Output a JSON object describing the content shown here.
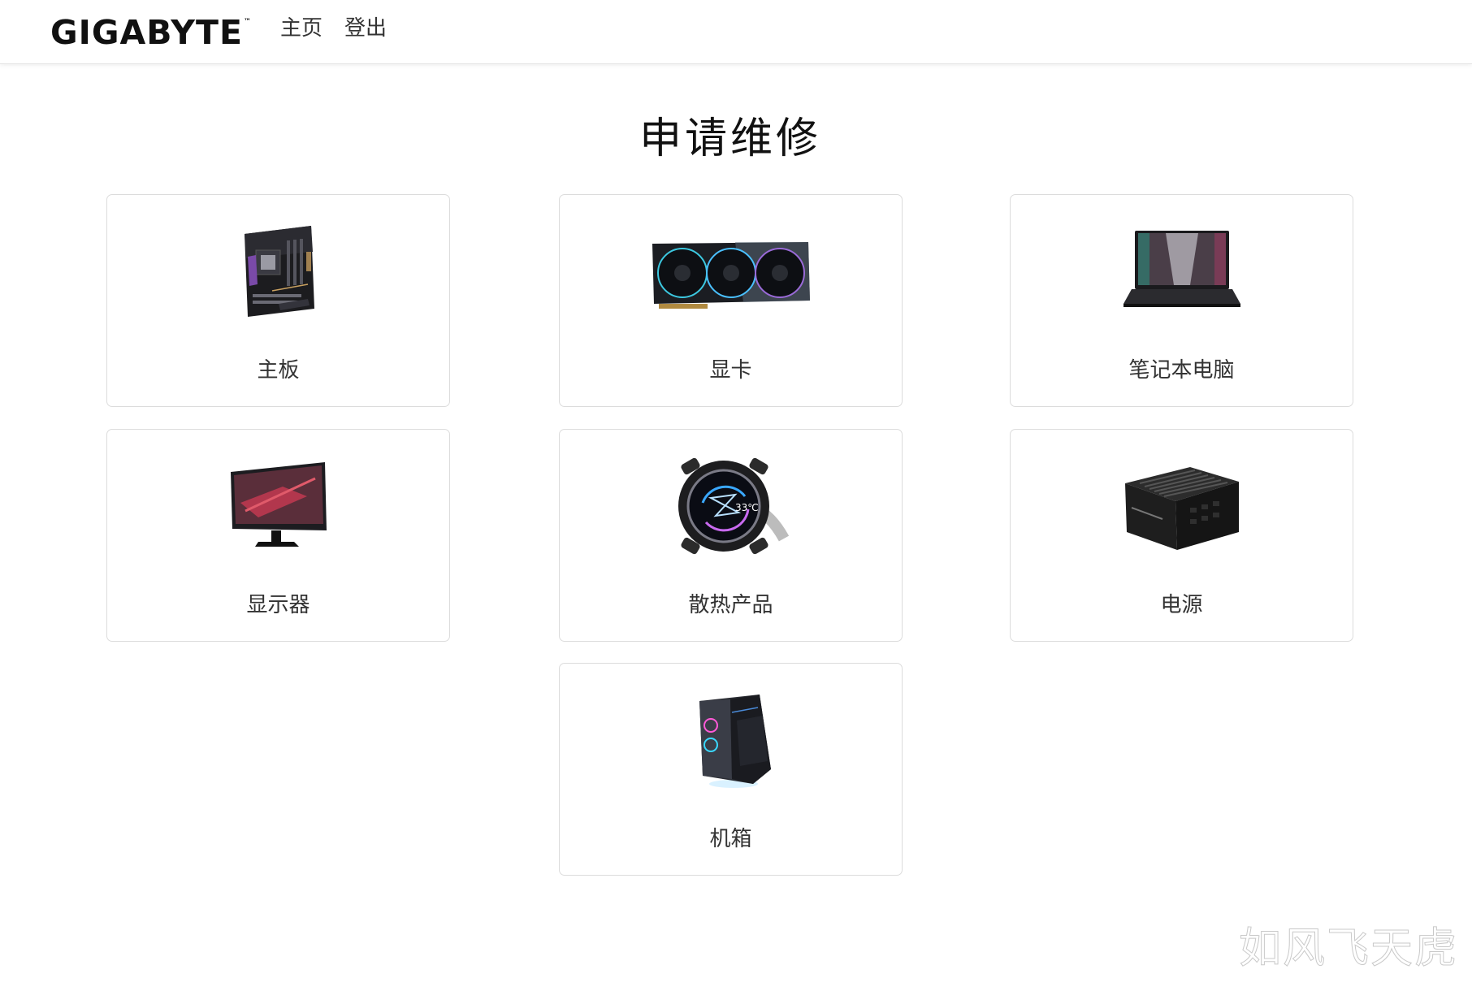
{
  "nav": {
    "logo": "GIGABYTE",
    "logo_tm": "™",
    "links": [
      {
        "label": "主页"
      },
      {
        "label": "登出"
      }
    ]
  },
  "page": {
    "title": "申请维修"
  },
  "categories": [
    {
      "label": "主板",
      "icon": "motherboard-icon"
    },
    {
      "label": "显卡",
      "icon": "graphics-card-icon"
    },
    {
      "label": "笔记本电脑",
      "icon": "laptop-icon"
    },
    {
      "label": "显示器",
      "icon": "monitor-icon"
    },
    {
      "label": "散热产品",
      "icon": "liquid-cooler-icon"
    },
    {
      "label": "电源",
      "icon": "power-supply-icon"
    },
    {
      "label": "机箱",
      "icon": "pc-case-icon"
    }
  ],
  "watermark": "如风飞天虎"
}
